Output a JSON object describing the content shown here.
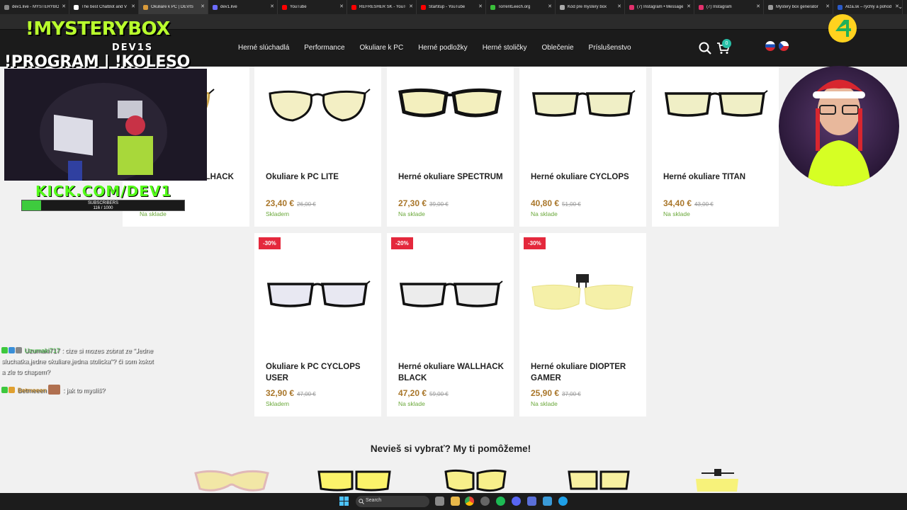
{
  "browser": {
    "tabs": [
      {
        "title": "dev1.live - MYSTERYBOX",
        "color": "#888888"
      },
      {
        "title": "The best ChatBot and V",
        "color": "#ffffff"
      },
      {
        "title": "Okuliare k PC | DEVIS",
        "color": "#d99a3a",
        "active": true
      },
      {
        "title": "dev1.live",
        "color": "#6b6bff"
      },
      {
        "title": "YouTube",
        "color": "#ff0000"
      },
      {
        "title": "REFRESHER SK - YouTub",
        "color": "#ff0000"
      },
      {
        "title": "Startitup - YouTube",
        "color": "#ff0000"
      },
      {
        "title": "TorrentLeech.org",
        "color": "#3ac03a"
      },
      {
        "title": "Kód pre mystery box",
        "color": "#aaaaaa"
      },
      {
        "title": "(7) Instagram • Message",
        "color": "#e1306c"
      },
      {
        "title": "(7) Instagram",
        "color": "#e1306c"
      },
      {
        "title": "Mystery box generator",
        "color": "#999999"
      },
      {
        "title": "Alza.sk – rýchly a pohod",
        "color": "#2a5ac8"
      }
    ]
  },
  "site": {
    "nav": [
      "Herné slúchadlá",
      "Performance",
      "Okuliare k PC",
      "Herné podložky",
      "Herné stoličky",
      "Oblečenie",
      "Príslušenstvo"
    ],
    "cart_count": "0",
    "languages": [
      "SK",
      "CZ"
    ]
  },
  "products": [
    {
      "name": "Herné okuliare WALLHACK",
      "price": "",
      "old_price": "",
      "stock": "Na sklade",
      "lens": "#f3e9a8",
      "style": "round-gold"
    },
    {
      "name": "Okuliare k PC LITE",
      "price": "23,40 €",
      "old_price": "26,00 €",
      "stock": "Skladem",
      "lens": "#f3efc4",
      "style": "round"
    },
    {
      "name": "Herné okuliare SPECTRUM",
      "price": "27,30 €",
      "old_price": "39,00 €",
      "stock": "Na sklade",
      "lens": "#f3efbe",
      "style": "sport"
    },
    {
      "name": "Herné okuliare CYCLOPS",
      "price": "40,80 €",
      "old_price": "51,00 €",
      "stock": "Na sklade",
      "lens": "#f0efc6",
      "style": "rect"
    },
    {
      "name": "Herné okuliare TITAN",
      "price": "34,40 €",
      "old_price": "43,00 €",
      "stock": "Na sklade",
      "lens": "#f0efc6",
      "style": "rect"
    },
    {
      "name": "Okuliare k PC CYCLOPS USER",
      "price": "32,90 €",
      "old_price": "47,00 €",
      "stock": "Skladem",
      "badge": "-30%",
      "lens": "#e8e8f2",
      "style": "rect"
    },
    {
      "name": "Herné okuliare WALLHACK BLACK",
      "price": "47,20 €",
      "old_price": "59,00 €",
      "stock": "Na sklade",
      "badge": "-20%",
      "lens": "#ececec",
      "style": "rect"
    },
    {
      "name": "Herné okuliare DIOPTER GAMER",
      "price": "25,90 €",
      "old_price": "37,00 €",
      "stock": "Na sklade",
      "badge": "-30%",
      "lens": "#f5f0a8",
      "style": "clip"
    }
  ],
  "help_title": "Nevieš si vybrať? My ti pomôžeme!",
  "stream": {
    "title1": "!MYSTERYBOX",
    "title2": "DEV1S",
    "title3": "!PROGRAM | !KOLESO",
    "kick": "KICK.COM/DEV1",
    "subs_label": "SUBSCRIBERS",
    "subs_count": "116 / 1000",
    "subs_fraction": 0.116,
    "chat": [
      {
        "user": "Uzumaki717",
        "text": ": cize si mozes zobrat ze \"Jedne sluchatka,jedne okuliare,jedna stolicka\"? či som kokot a zle to chapem?"
      },
      {
        "user": "Betmeeen",
        "text": ": jak to myslíš?"
      }
    ]
  },
  "taskbar": {
    "search_label": "Search"
  }
}
